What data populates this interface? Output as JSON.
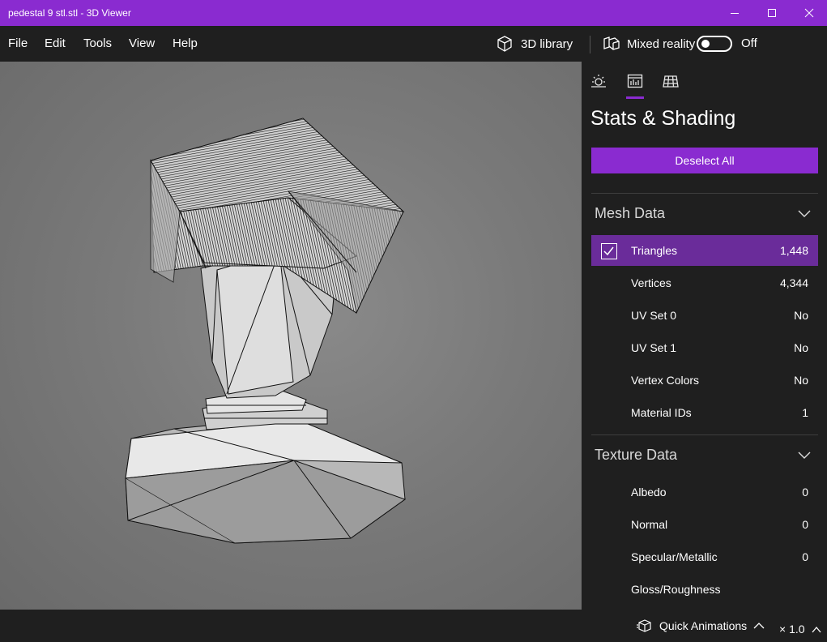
{
  "window": {
    "title": "pedestal 9 stl.stl - 3D Viewer"
  },
  "menu": {
    "items": [
      {
        "label": "File"
      },
      {
        "label": "Edit"
      },
      {
        "label": "Tools"
      },
      {
        "label": "View"
      },
      {
        "label": "Help"
      }
    ],
    "library_label": "3D library",
    "mixed_reality_label": "Mixed reality",
    "mixed_reality_state": "Off"
  },
  "panel": {
    "tabs": [
      {
        "icon": "sun-icon"
      },
      {
        "icon": "stats-icon",
        "selected": true
      },
      {
        "icon": "grid-icon"
      }
    ],
    "title": "Stats & Shading",
    "deselect_label": "Deselect All",
    "mesh_section": {
      "title": "Mesh Data",
      "rows": [
        {
          "label": "Triangles",
          "value": "1,448",
          "selected": true
        },
        {
          "label": "Vertices",
          "value": "4,344"
        },
        {
          "label": "UV Set 0",
          "value": "No"
        },
        {
          "label": "UV Set 1",
          "value": "No"
        },
        {
          "label": "Vertex Colors",
          "value": "No"
        },
        {
          "label": "Material IDs",
          "value": "1"
        }
      ]
    },
    "texture_section": {
      "title": "Texture Data",
      "rows": [
        {
          "label": "Albedo",
          "value": "0"
        },
        {
          "label": "Normal",
          "value": "0"
        },
        {
          "label": "Specular/Metallic",
          "value": "0"
        },
        {
          "label": "Gloss/Roughness",
          "value": ""
        }
      ]
    }
  },
  "status": {
    "quick_animations_label": "Quick Animations",
    "speed_label": "× 1.0"
  },
  "colors": {
    "accent": "#8a2bd0",
    "selected_row": "#6a2c9a",
    "background": "#1f1f1f"
  }
}
